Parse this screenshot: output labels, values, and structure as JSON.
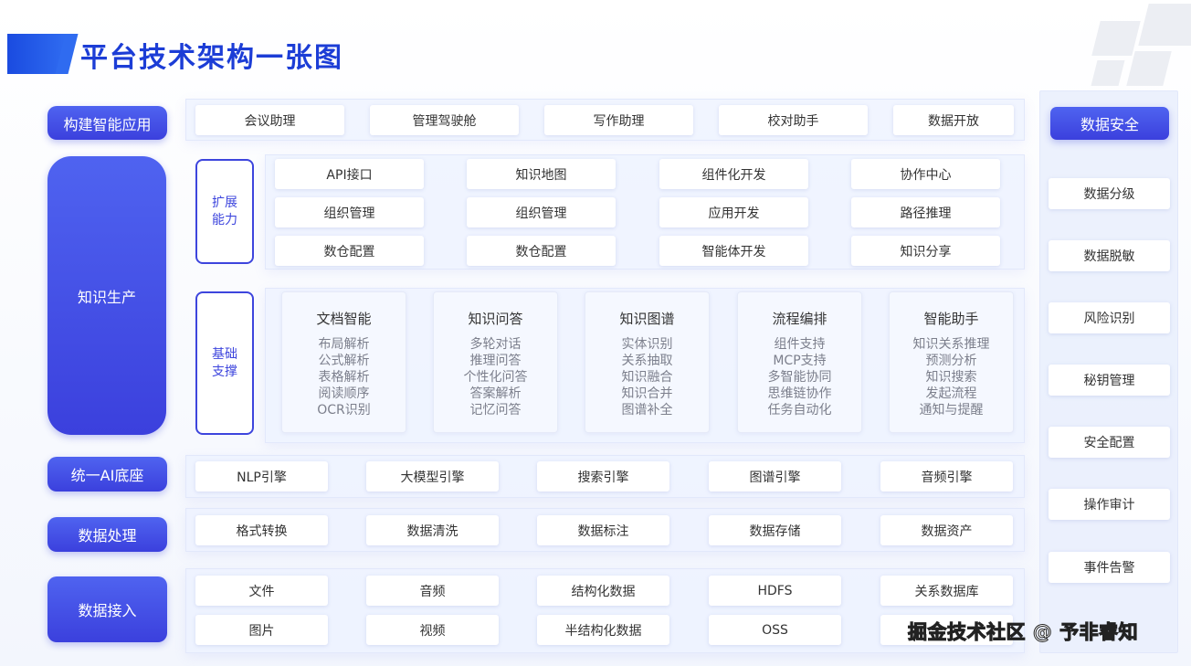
{
  "title": "平台技术架构一张图",
  "left_labels": {
    "apps": "构建智能应用",
    "knowledge": "知识生产",
    "ai_base": "统一AI底座",
    "data_processing": "数据处理",
    "data_ingest": "数据接入"
  },
  "apps_row": [
    "会议助理",
    "管理驾驶舱",
    "写作助理",
    "校对助手",
    "数据开放"
  ],
  "extend": {
    "tag": "扩展\n能力",
    "chips": [
      [
        "API接口",
        "知识地图",
        "组件化开发",
        "协作中心"
      ],
      [
        "组织管理",
        "组织管理",
        "应用开发",
        "路径推理"
      ],
      [
        "数仓配置",
        "数仓配置",
        "智能体开发",
        "知识分享"
      ]
    ]
  },
  "base": {
    "tag": "基础\n支撑",
    "cards": [
      {
        "title": "文档智能",
        "items": [
          "布局解析",
          "公式解析",
          "表格解析",
          "阅读顺序",
          "OCR识别"
        ]
      },
      {
        "title": "知识问答",
        "items": [
          "多轮对话",
          "推理问答",
          "个性化问答",
          "答案解析",
          "记忆问答"
        ]
      },
      {
        "title": "知识图谱",
        "items": [
          "实体识别",
          "关系抽取",
          "知识融合",
          "知识合并",
          "图谱补全"
        ]
      },
      {
        "title": "流程编排",
        "items": [
          "组件支持",
          "MCP支持",
          "多智能协同",
          "思维链协作",
          "任务自动化"
        ]
      },
      {
        "title": "智能助手",
        "items": [
          "知识关系推理",
          "预测分析",
          "知识搜索",
          "发起流程",
          "通知与提醒"
        ]
      }
    ]
  },
  "ai_base_row": [
    "NLP引擎",
    "大模型引擎",
    "搜索引擎",
    "图谱引擎",
    "音频引擎"
  ],
  "processing_row": [
    "格式转换",
    "数据清洗",
    "数据标注",
    "数据存储",
    "数据资产"
  ],
  "ingest_rows": [
    [
      "文件",
      "音频",
      "结构化数据",
      "HDFS",
      "关系数据库"
    ],
    [
      "图片",
      "视频",
      "半结构化数据",
      "OSS",
      ""
    ]
  ],
  "security": {
    "title": "数据安全",
    "items": [
      "数据分级",
      "数据脱敏",
      "风险识别",
      "秘钥管理",
      "安全配置",
      "操作审计",
      "事件告警"
    ]
  },
  "watermark": "掘金技术社区 @ 予非睿知"
}
